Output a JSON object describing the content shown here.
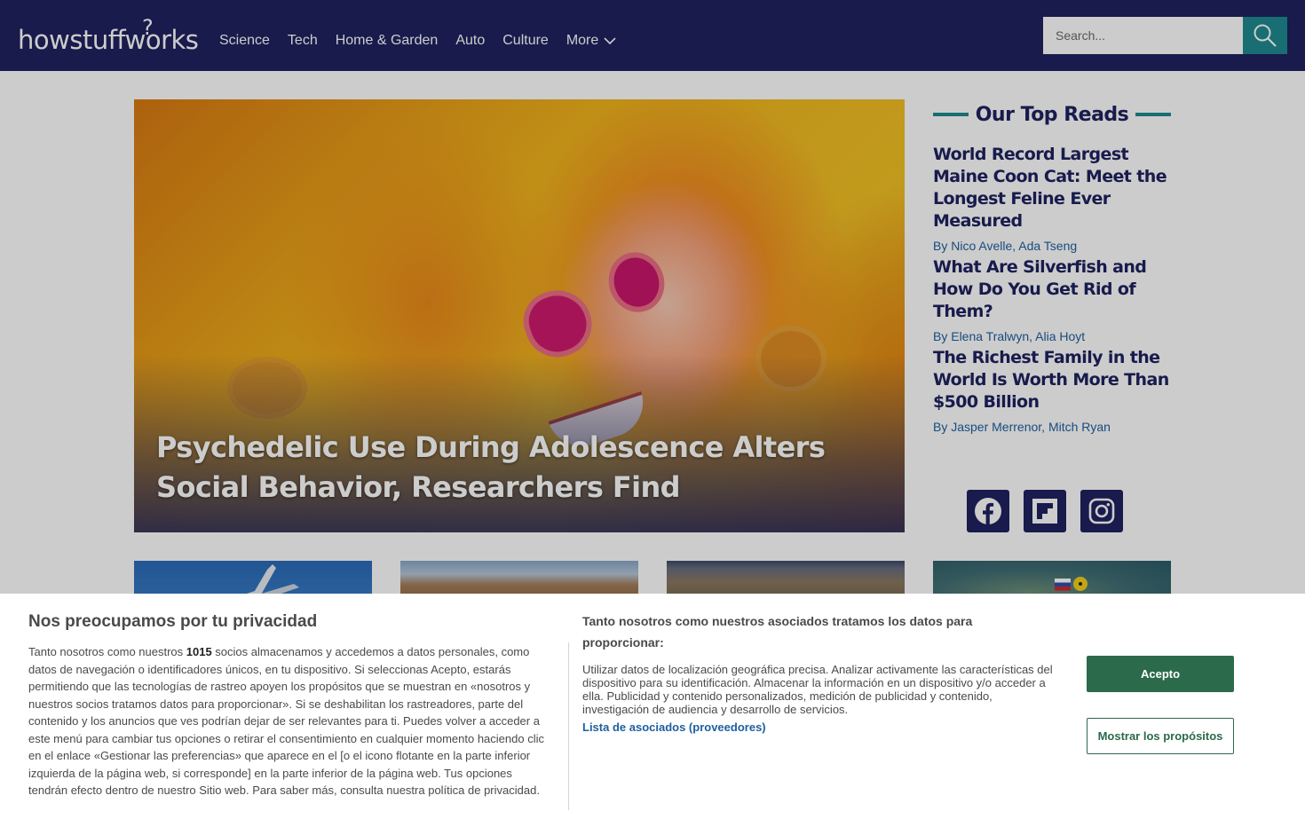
{
  "header": {
    "logo": "howstuffworks",
    "nav": [
      "Science",
      "Tech",
      "Home & Garden",
      "Auto",
      "Culture"
    ],
    "more_label": "More",
    "search_placeholder": "Search..."
  },
  "hero": {
    "title": "Psychedelic Use During Adolescence Alters Social Behavior, Researchers Find"
  },
  "top_reads": {
    "heading": "Our Top Reads",
    "items": [
      {
        "title": "World Record Largest Maine Coon Cat: Meet the Longest Feline Ever Measured",
        "by": "By",
        "authors": "Nico Avelle, Ada Tseng"
      },
      {
        "title": "What Are Silverfish and How Do You Get Rid of Them?",
        "by": "By",
        "authors": "Elena Tralwyn, Alia Hoyt"
      },
      {
        "title": "The Richest Family in the World Is Worth More Than $500 Billion",
        "by": "By",
        "authors": "Jasper Merrenor, Mitch Ryan"
      }
    ]
  },
  "social": [
    "facebook-icon",
    "flipboard-icon",
    "instagram-icon"
  ],
  "consent": {
    "title": "Nos preocupamos por tu privacidad",
    "body_pre": "Tanto nosotros como nuestros ",
    "partner_count": "1015",
    "body_post": " socios almacenamos y accedemos a datos personales, como datos de navegación o identificadores únicos, en tu dispositivo. Si seleccionas Acepto, estarás permitiendo que las tecnologías de rastreo apoyen los propósitos que se muestran en «nosotros y nuestros socios tratamos datos para proporcionar». Si se deshabilitan los rastreadores, parte del contenido y los anuncios que ves podrían dejar de ser relevantes para ti. Puedes volver a acceder a este menú para cambiar tus opciones o retirar el consentimiento en cualquier momento haciendo clic en el enlace «Gestionar las preferencias» que aparece en el [o el icono flotante en la parte inferior izquierda de la página web, si corresponde] en la parte inferior de la página web. Tus opciones tendrán efecto dentro de nuestro Sitio web. Para saber más, consulta nuestra política de privacidad.",
    "subtitle": "Tanto nosotros como nuestros asociados tratamos los datos para proporcionar:",
    "purposes": "Utilizar datos de localización geográfica precisa. Analizar activamente las características del dispositivo para su identificación. Almacenar la información en un dispositivo y/o acceder a ella. Publicidad y contenido personalizados, medición de publicidad y contenido, investigación de audiencia y desarrollo de servicios.",
    "vendors_link": "Lista de asociados (proveedores)",
    "accept_label": "Acepto",
    "purposes_label": "Mostrar los propósitos"
  },
  "colors": {
    "header_bg": "#1e2260",
    "accent_teal": "#1f8a8f",
    "accept_green": "#2b6a4a",
    "link_blue": "#1f5fa0"
  }
}
